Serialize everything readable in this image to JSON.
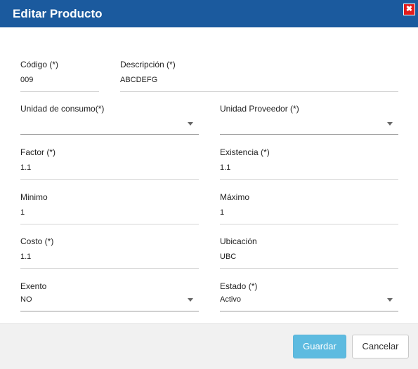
{
  "dialog": {
    "title": "Editar Producto",
    "close_label": "✖"
  },
  "form": {
    "codigo": {
      "label": "Código (*)",
      "value": "009"
    },
    "descripcion": {
      "label": "Descripción (*)",
      "value": "ABCDEFG"
    },
    "unidad_consumo": {
      "label": "Unidad de consumo(*)",
      "value": ""
    },
    "unidad_proveedor": {
      "label": "Unidad Proveedor (*)",
      "value": ""
    },
    "factor": {
      "label": "Factor (*)",
      "value": "1.1"
    },
    "existencia": {
      "label": "Existencia (*)",
      "value": "1.1"
    },
    "minimo": {
      "label": "Minimo",
      "value": "1"
    },
    "maximo": {
      "label": "Máximo",
      "value": "1"
    },
    "costo": {
      "label": "Costo (*)",
      "value": "1.1"
    },
    "ubicacion": {
      "label": "Ubicación",
      "value": "UBC"
    },
    "exento": {
      "label": "Exento",
      "value": "NO"
    },
    "estado": {
      "label": "Estado (*)",
      "value": "Activo"
    }
  },
  "footer": {
    "save_label": "Guardar",
    "cancel_label": "Cancelar"
  },
  "colors": {
    "header": "#1b5a9e",
    "close": "#e41b1b",
    "save_button": "#5dbbe0"
  },
  "icons": {
    "close": "close-icon",
    "dropdown": "chevron-down-icon"
  }
}
